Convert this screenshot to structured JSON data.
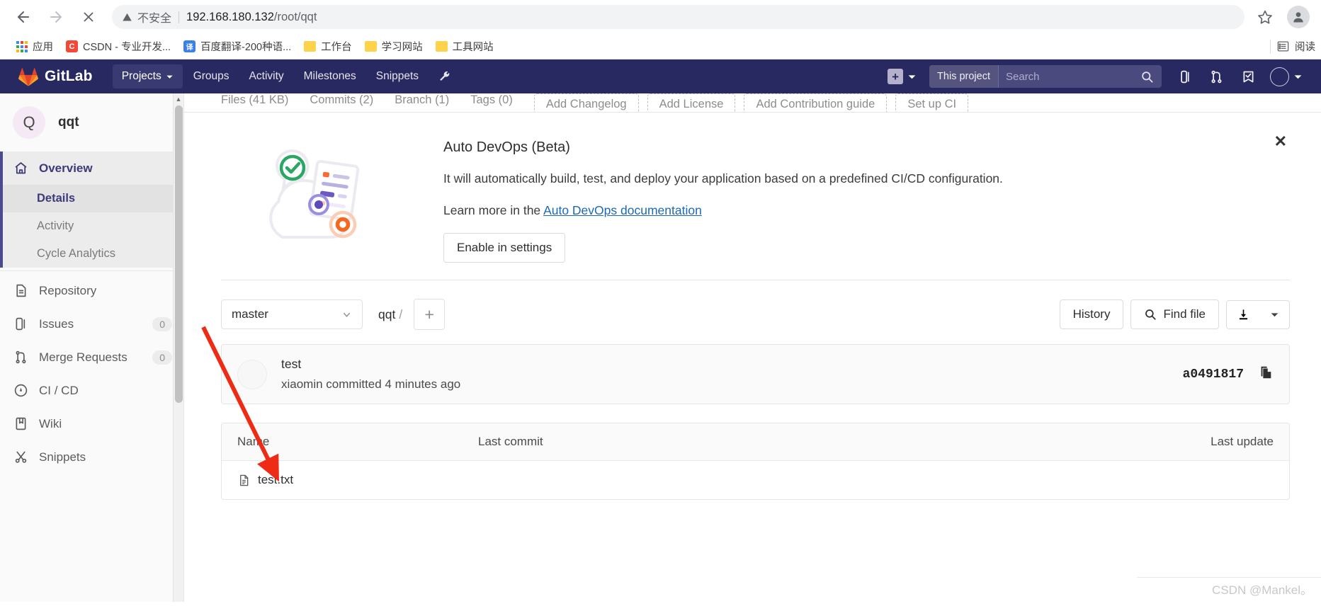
{
  "browser": {
    "back_label": "Back",
    "forward_label": "Forward",
    "stop_label": "Stop",
    "security_warning": "不安全",
    "url_host": "192.168.180.132",
    "url_path": "/root/qqt",
    "bookmark_star_label": "Bookmark this tab",
    "profile_label": "Profile",
    "bookmarks": [
      {
        "label": "应用",
        "icon": "apps-grid-icon"
      },
      {
        "label": "CSDN - 专业开发...",
        "icon": "csdn-favicon",
        "badge": "C",
        "color": "#f24a36"
      },
      {
        "label": "百度翻译-200种语...",
        "icon": "baidu-fanyi-favicon",
        "badge": "译",
        "color": "#3b7fe8"
      },
      {
        "label": "工作台",
        "icon": "folder-icon"
      },
      {
        "label": "学习网站",
        "icon": "folder-icon"
      },
      {
        "label": "工具网站",
        "icon": "folder-icon"
      }
    ],
    "reading_list_label": "阅读",
    "reading_list_icon": "reading-list-icon"
  },
  "gitlab": {
    "brand": "GitLab",
    "nav": [
      {
        "label": "Projects",
        "has_caret": true,
        "active": true
      },
      {
        "label": "Groups",
        "has_caret": false,
        "active": false
      },
      {
        "label": "Activity",
        "has_caret": false,
        "active": false
      },
      {
        "label": "Milestones",
        "has_caret": false,
        "active": false
      },
      {
        "label": "Snippets",
        "has_caret": false,
        "active": false
      }
    ],
    "wrench_icon": "wrench-icon",
    "new_label": "+",
    "search": {
      "scope": "This project",
      "placeholder": "Search",
      "value": ""
    },
    "header_icons": [
      {
        "name": "issues-icon"
      },
      {
        "name": "merge-requests-icon"
      },
      {
        "name": "todos-icon"
      }
    ]
  },
  "sidebar": {
    "project_initial": "Q",
    "project_name": "qqt",
    "overview": {
      "label": "Overview",
      "icon": "home-icon"
    },
    "overview_children": [
      {
        "label": "Details",
        "selected": true
      },
      {
        "label": "Activity",
        "selected": false
      },
      {
        "label": "Cycle Analytics",
        "selected": false
      }
    ],
    "items": [
      {
        "label": "Repository",
        "icon": "document-icon",
        "badge": ""
      },
      {
        "label": "Issues",
        "icon": "issues-icon",
        "badge": "0"
      },
      {
        "label": "Merge Requests",
        "icon": "merge-requests-icon",
        "badge": "0"
      },
      {
        "label": "CI / CD",
        "icon": "rocket-gauge-icon",
        "badge": ""
      },
      {
        "label": "Wiki",
        "icon": "book-icon",
        "badge": ""
      },
      {
        "label": "Snippets",
        "icon": "scissors-icon",
        "badge": ""
      }
    ]
  },
  "stats": {
    "links": [
      "Files (41 KB)",
      "Commits (2)",
      "Branch (1)",
      "Tags (0)"
    ],
    "dashed_buttons": [
      "Add Changelog",
      "Add License",
      "Add Contribution guide",
      "Set up CI"
    ]
  },
  "auto_devops": {
    "title": "Auto DevOps (Beta)",
    "description": "It will automatically build, test, and deploy your application based on a predefined CI/CD configuration.",
    "learn_prefix": "Learn more in the ",
    "learn_link": "Auto DevOps documentation",
    "enable_button": "Enable in settings",
    "close_label": "✕",
    "illustration_icon": "auto-devops-cloud-illustration"
  },
  "tree_toolbar": {
    "branch": "master",
    "breadcrumb_project": "qqt",
    "breadcrumb_sep": "/",
    "add_label": "+",
    "history_label": "History",
    "find_file_label": "Find file",
    "download_icon": "download-icon"
  },
  "commit": {
    "title": "test",
    "meta": "xiaomin committed 4 minutes ago",
    "sha": "a0491817",
    "copy_icon": "copy-icon"
  },
  "file_table": {
    "columns": [
      "Name",
      "Last commit",
      "Last update"
    ],
    "rows": [
      {
        "name": "test.txt",
        "icon": "file-text-icon",
        "last_commit": "",
        "last_update": ""
      }
    ]
  },
  "watermark": "CSDN @Mankel。",
  "colors": {
    "gitlab_header": "#292961",
    "accent": "#4b4a8f",
    "link": "#1b69b6",
    "annotation_arrow": "#ee2b15"
  }
}
